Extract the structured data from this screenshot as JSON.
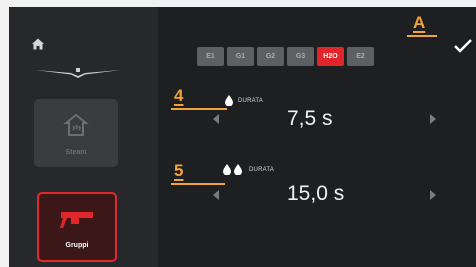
{
  "sidebar": {
    "tiles": [
      {
        "label": "Steam",
        "state": "disabled"
      },
      {
        "label": "Gruppi",
        "state": "selected"
      }
    ]
  },
  "tabs": [
    {
      "label": "E1",
      "active": false
    },
    {
      "label": "G1",
      "active": false
    },
    {
      "label": "G2",
      "active": false
    },
    {
      "label": "G3",
      "active": false
    },
    {
      "label": "H2O",
      "active": true
    },
    {
      "label": "E2",
      "active": false
    }
  ],
  "callouts": {
    "a": "A",
    "four": "4",
    "five": "5"
  },
  "params": [
    {
      "label": "DURATA",
      "value": "7,5 s",
      "drops": 1
    },
    {
      "label": "DURATA",
      "value": "15,0 s",
      "drops": 2
    }
  ],
  "colors": {
    "accent": "#e1262b",
    "callout": "#f2a33b",
    "background": "#1d1f21"
  }
}
